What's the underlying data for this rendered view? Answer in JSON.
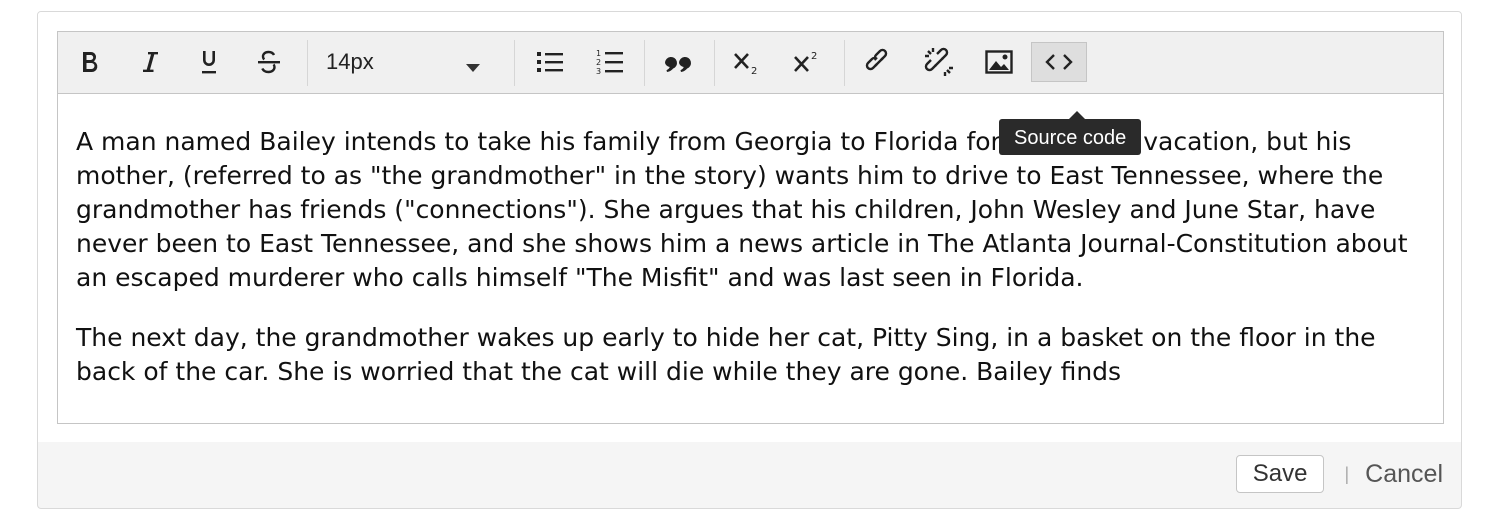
{
  "toolbar": {
    "buttons": [
      {
        "name": "bold-button",
        "icon": "bold-icon"
      },
      {
        "name": "italic-button",
        "icon": "italic-icon"
      },
      {
        "name": "underline-button",
        "icon": "underline-icon"
      },
      {
        "name": "strikethrough-button",
        "icon": "strikethrough-icon"
      },
      {
        "name": "bullet-list-button",
        "icon": "bullet-list-icon"
      },
      {
        "name": "numbered-list-button",
        "icon": "numbered-list-icon"
      },
      {
        "name": "blockquote-button",
        "icon": "quote-icon"
      },
      {
        "name": "subscript-button",
        "icon": "subscript-icon"
      },
      {
        "name": "superscript-button",
        "icon": "superscript-icon"
      },
      {
        "name": "link-button",
        "icon": "link-icon"
      },
      {
        "name": "unlink-button",
        "icon": "unlink-icon"
      },
      {
        "name": "image-button",
        "icon": "image-icon"
      },
      {
        "name": "source-code-button",
        "icon": "code-icon"
      }
    ],
    "font_size": "14px",
    "tooltip": "Source code"
  },
  "content": {
    "paragraphs": [
      "A man named Bailey intends to take his family from Georgia to Florida for a summer vacation, but his mother, (referred to as \"the grandmother\" in the story) wants him to drive to East Tennessee, where the grandmother has friends (\"connections\"). She argues that his children, John Wesley and June Star, have never been to East Tennessee, and she shows him a news article in The Atlanta Journal-Constitution about an escaped murderer who calls himself \"The Misfit\" and was last seen in Florida.",
      "The next day, the grandmother wakes up early to hide her cat, Pitty Sing, in a basket on the floor in the back of the car. She is worried that the cat will die while they are gone. Bailey finds"
    ]
  },
  "actions": {
    "save_label": "Save",
    "divider": "|",
    "cancel_label": "Cancel"
  }
}
